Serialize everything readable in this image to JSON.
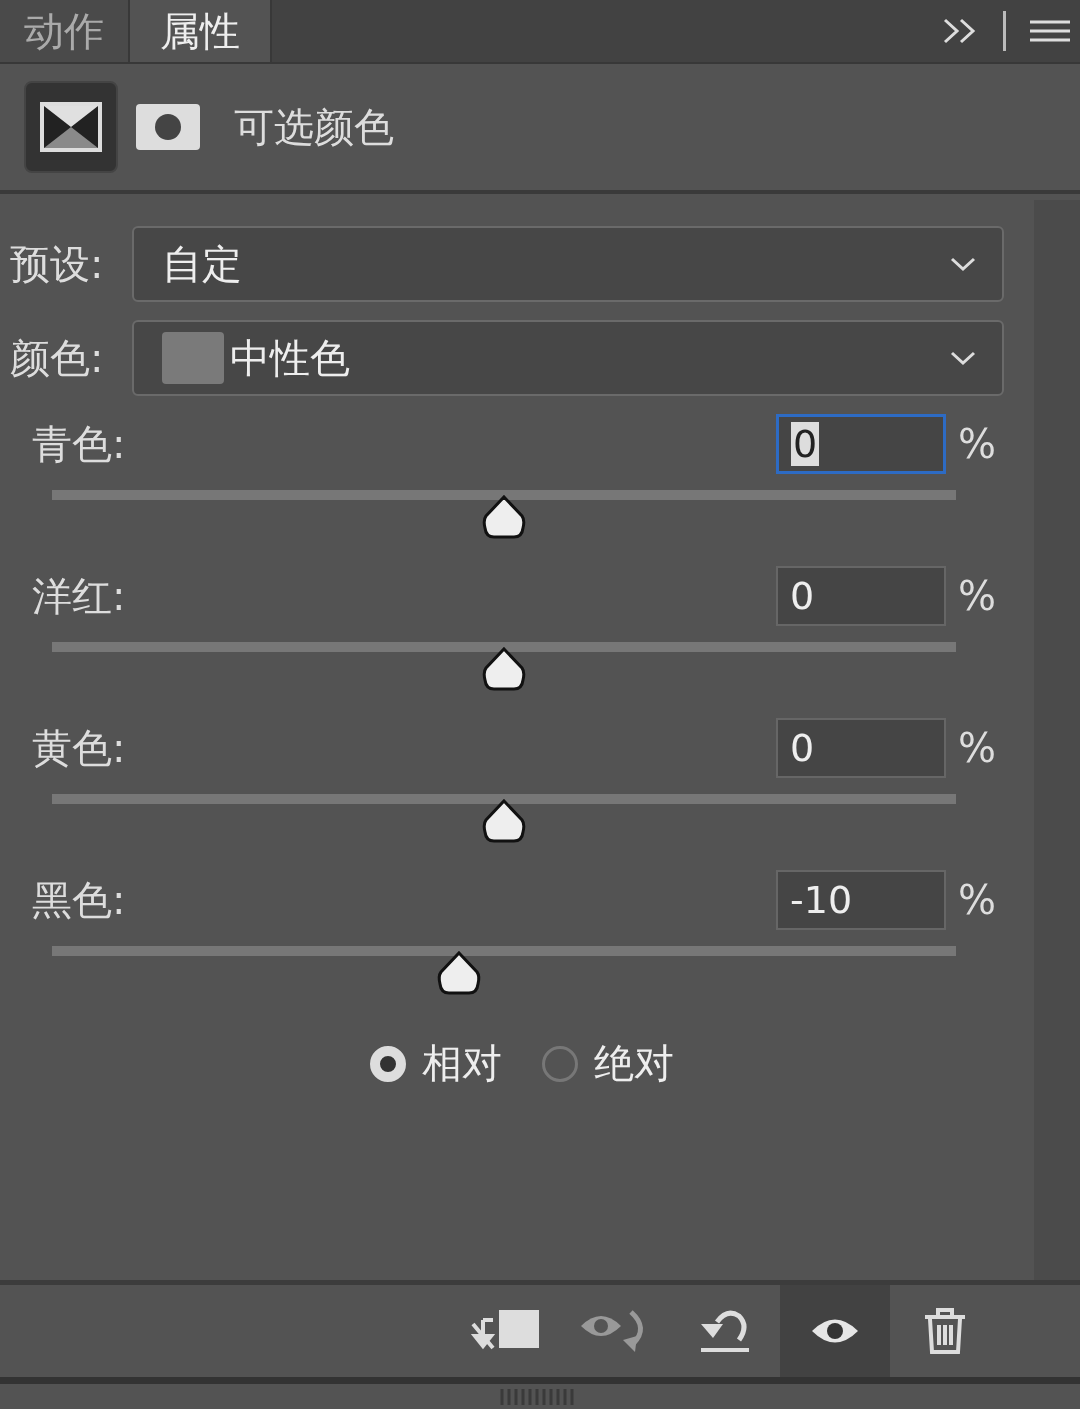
{
  "tabs": [
    {
      "label": "动作",
      "selected": false
    },
    {
      "label": "属性",
      "selected": true
    }
  ],
  "adjustment": {
    "title": "可选颜色"
  },
  "preset": {
    "label": "预设:",
    "value": "自定"
  },
  "color": {
    "label": "颜色:",
    "value": "中性色"
  },
  "sliders": [
    {
      "label": "青色:",
      "value": "0",
      "unit": "%",
      "level": 0.5,
      "focused": true
    },
    {
      "label": "洋红:",
      "value": "0",
      "unit": "%",
      "level": 0.5,
      "focused": false
    },
    {
      "label": "黄色:",
      "value": "0",
      "unit": "%",
      "level": 0.5,
      "focused": false
    },
    {
      "label": "黑色:",
      "value": "-10",
      "unit": "%",
      "level": 0.45,
      "focused": false
    }
  ],
  "method": [
    {
      "label": "相对",
      "selected": true
    },
    {
      "label": "绝对",
      "selected": false
    }
  ],
  "toolbar": [
    {
      "kind": "clip",
      "pressed": false
    },
    {
      "kind": "previous",
      "pressed": false
    },
    {
      "kind": "reset",
      "pressed": false
    },
    {
      "kind": "visibility",
      "pressed": true
    },
    {
      "kind": "delete",
      "pressed": false
    }
  ]
}
